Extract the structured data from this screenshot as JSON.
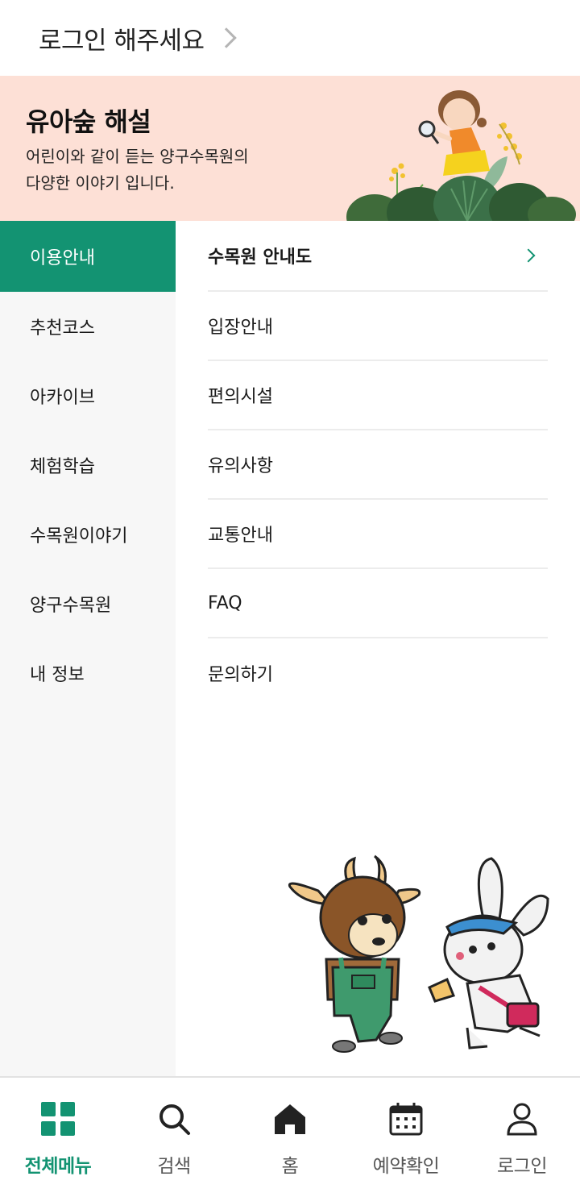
{
  "header": {
    "login_prompt": "로그인 해주세요"
  },
  "banner": {
    "title": "유아숲 해설",
    "description_line1": "어린이와 같이 듣는 양구수목원의",
    "description_line2": "다양한 이야기 입니다."
  },
  "sidebar": {
    "items": [
      {
        "label": "이용안내",
        "active": true
      },
      {
        "label": "추천코스"
      },
      {
        "label": "아카이브"
      },
      {
        "label": "체험학습"
      },
      {
        "label": "수목원이야기"
      },
      {
        "label": "양구수목원"
      },
      {
        "label": "내 정보"
      }
    ]
  },
  "submenu": {
    "items": [
      {
        "label": "수목원 안내도"
      },
      {
        "label": "입장안내"
      },
      {
        "label": "편의시설"
      },
      {
        "label": "유의사항"
      },
      {
        "label": "교통안내"
      },
      {
        "label": "FAQ"
      },
      {
        "label": "문의하기"
      }
    ]
  },
  "bottom_nav": {
    "items": [
      {
        "label": "전체메뉴",
        "icon": "grid-icon",
        "active": true
      },
      {
        "label": "검색",
        "icon": "search-icon"
      },
      {
        "label": "홈",
        "icon": "home-icon"
      },
      {
        "label": "예약확인",
        "icon": "calendar-icon"
      },
      {
        "label": "로그인",
        "icon": "user-icon"
      }
    ]
  },
  "colors": {
    "accent": "#139372",
    "banner_bg": "#fde0d6",
    "sidebar_bg": "#f7f7f7"
  }
}
